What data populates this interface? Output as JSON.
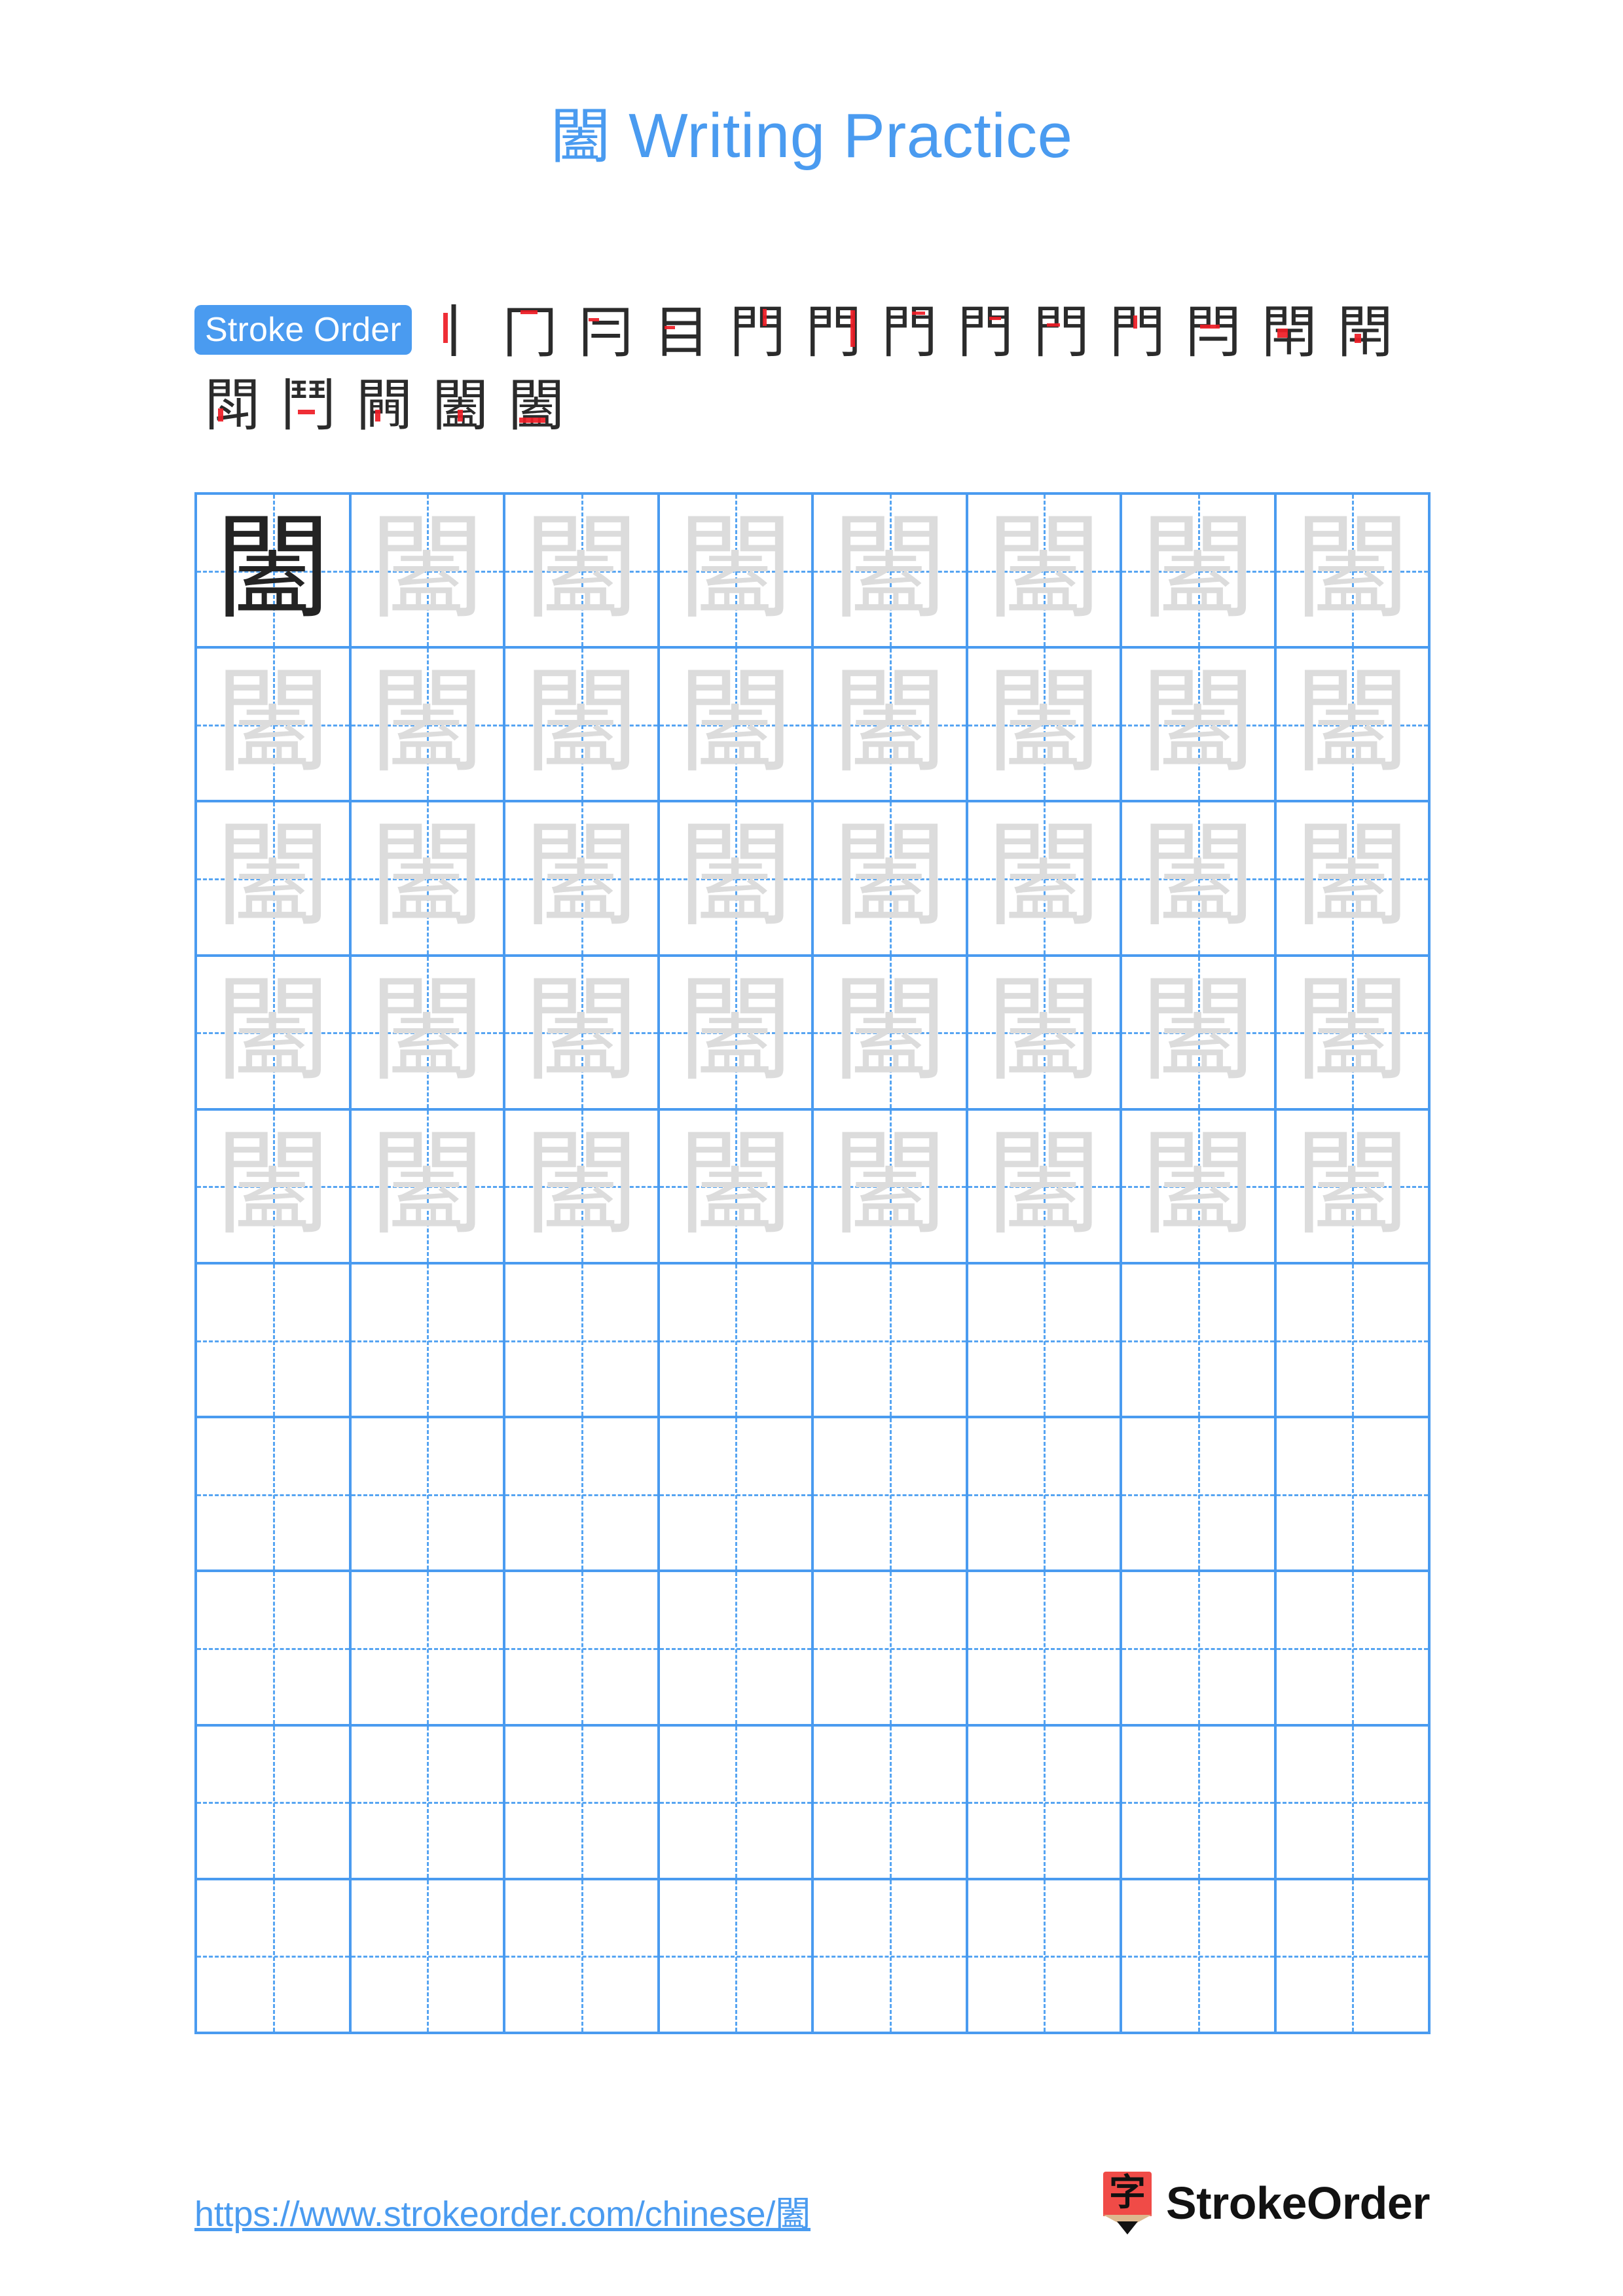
{
  "character": "闔",
  "header": {
    "title_character": "闔",
    "title_text": "Writing Practice"
  },
  "stroke_order": {
    "badge_label": "Stroke Order",
    "total_strokes": 18,
    "highlight_color": "#ee1c25",
    "ink_color": "#2b2b2b",
    "steps": [
      "丨",
      "冂",
      "冃",
      "目",
      "門",
      "門",
      "門",
      "門",
      "門",
      "門",
      "閂",
      "閈",
      "閈",
      "閗",
      "鬥",
      "闁",
      "闔",
      "闔"
    ],
    "row1_count": 12,
    "row2_count": 6
  },
  "grid": {
    "columns": 8,
    "rows": 10,
    "border_color": "#4A9BF0",
    "guide_color": "#57A5F2",
    "trace_color": "#DCDCDC",
    "model_color": "#232323",
    "rows_data": [
      {
        "cells": [
          "闔",
          "闔",
          "闔",
          "闔",
          "闔",
          "闔",
          "闔",
          "闔"
        ],
        "first_is_model": true
      },
      {
        "cells": [
          "闔",
          "闔",
          "闔",
          "闔",
          "闔",
          "闔",
          "闔",
          "闔"
        ],
        "first_is_model": false
      },
      {
        "cells": [
          "闔",
          "闔",
          "闔",
          "闔",
          "闔",
          "闔",
          "闔",
          "闔"
        ],
        "first_is_model": false
      },
      {
        "cells": [
          "闔",
          "闔",
          "闔",
          "闔",
          "闔",
          "闔",
          "闔",
          "闔"
        ],
        "first_is_model": false
      },
      {
        "cells": [
          "闔",
          "闔",
          "闔",
          "闔",
          "闔",
          "闔",
          "闔",
          "闔"
        ],
        "first_is_model": false
      },
      {
        "cells": [
          "",
          "",
          "",
          "",
          "",
          "",
          "",
          ""
        ],
        "first_is_model": false
      },
      {
        "cells": [
          "",
          "",
          "",
          "",
          "",
          "",
          "",
          ""
        ],
        "first_is_model": false
      },
      {
        "cells": [
          "",
          "",
          "",
          "",
          "",
          "",
          "",
          ""
        ],
        "first_is_model": false
      },
      {
        "cells": [
          "",
          "",
          "",
          "",
          "",
          "",
          "",
          ""
        ],
        "first_is_model": false
      },
      {
        "cells": [
          "",
          "",
          "",
          "",
          "",
          "",
          "",
          ""
        ],
        "first_is_model": false
      }
    ]
  },
  "footer": {
    "url": "https://www.strokeorder.com/chinese/闔",
    "brand_name": "StrokeOrder",
    "brand_mark_character": "字",
    "brand_mark_color": "#F04B47",
    "link_color": "#4A9BF0"
  }
}
